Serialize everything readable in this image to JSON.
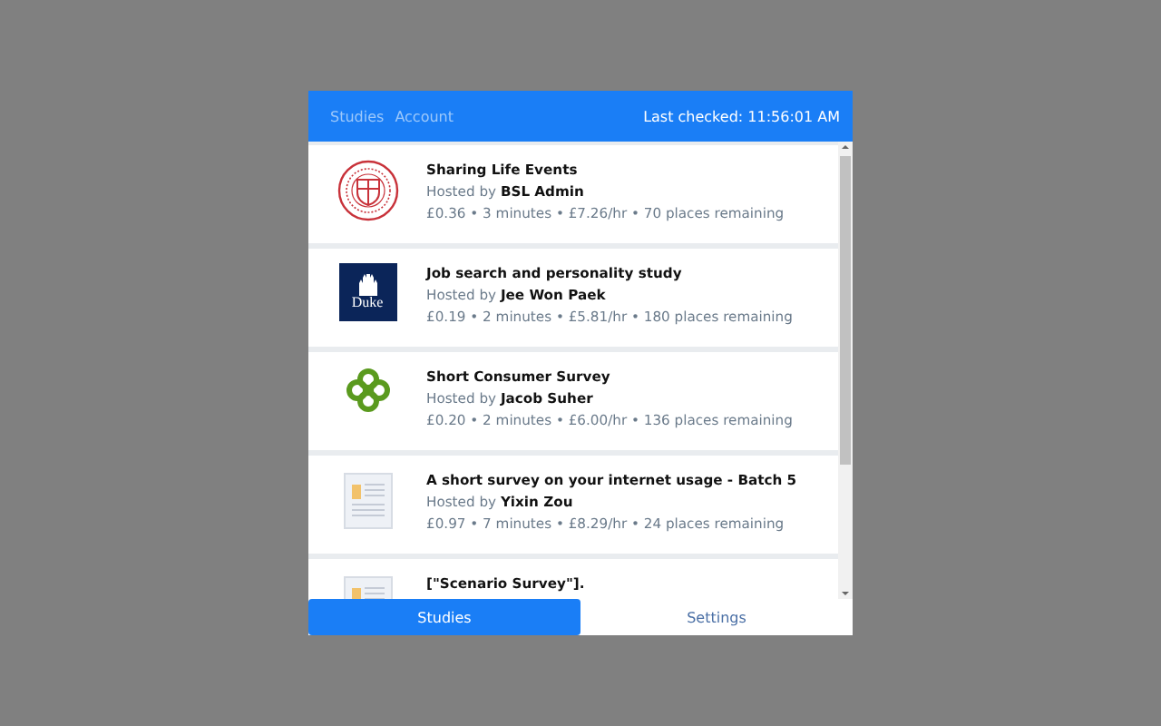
{
  "header": {
    "tabs": [
      {
        "label": "Studies",
        "selected": false
      },
      {
        "label": "Account",
        "selected": false
      }
    ],
    "status": "Last checked: 11:56:01 AM"
  },
  "studies": [
    {
      "kind": "seal",
      "title": "Sharing Life Events",
      "hosted_prefix": "Hosted by",
      "host": "BSL Admin",
      "meta": "£0.36 • 3 minutes • £7.26/hr • 70 places remaining"
    },
    {
      "kind": "duke",
      "logo_text": "Duke",
      "title": "Job search and personality study",
      "hosted_prefix": "Hosted by",
      "host": "Jee Won Paek",
      "meta": "£0.19 • 2 minutes • £5.81/hr • 180 places remaining"
    },
    {
      "kind": "knot",
      "title": "Short Consumer Survey",
      "hosted_prefix": "Hosted by",
      "host": "Jacob Suher",
      "meta": "£0.20 • 2 minutes • £6.00/hr • 136 places remaining"
    },
    {
      "kind": "document",
      "title": "A short survey on your internet usage - Batch 5",
      "hosted_prefix": "Hosted by",
      "host": "Yixin Zou",
      "meta": "£0.97 • 7 minutes • £8.29/hr • 24 places remaining"
    },
    {
      "kind": "document",
      "title": "[\"Scenario Survey\"]."
    }
  ],
  "bottom_tabs": [
    {
      "label": "Studies",
      "selected": true
    },
    {
      "label": "Settings",
      "selected": false
    }
  ]
}
